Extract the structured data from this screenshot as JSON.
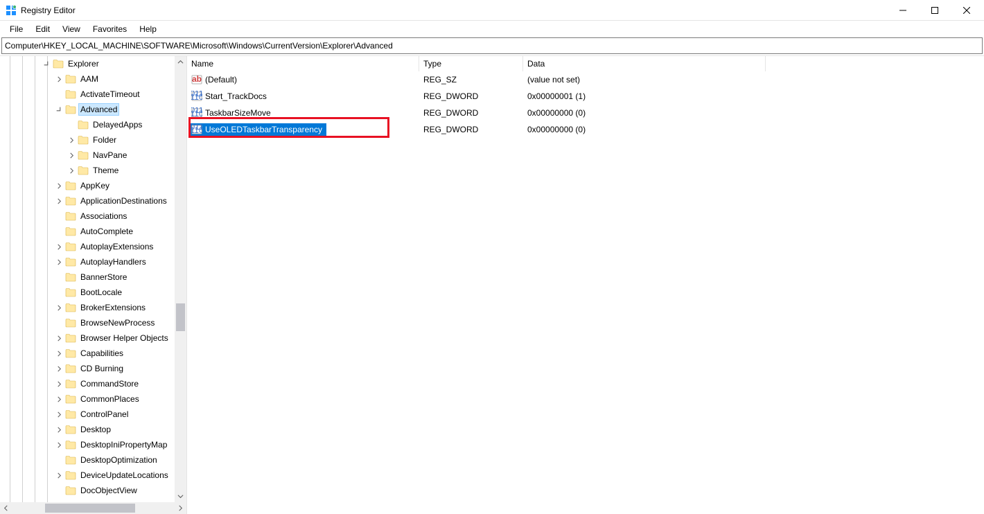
{
  "window": {
    "title": "Registry Editor"
  },
  "menu": [
    "File",
    "Edit",
    "View",
    "Favorites",
    "Help"
  ],
  "address": "Computer\\HKEY_LOCAL_MACHINE\\SOFTWARE\\Microsoft\\Windows\\CurrentVersion\\Explorer\\Advanced",
  "tree": [
    {
      "level": 3,
      "label": "Explorer",
      "expander": "open",
      "selected": false
    },
    {
      "level": 4,
      "label": "AAM",
      "expander": "closed"
    },
    {
      "level": 4,
      "label": "ActivateTimeout",
      "expander": "none"
    },
    {
      "level": 4,
      "label": "Advanced",
      "expander": "open",
      "selected": true
    },
    {
      "level": 5,
      "label": "DelayedApps",
      "expander": "none"
    },
    {
      "level": 5,
      "label": "Folder",
      "expander": "closed"
    },
    {
      "level": 5,
      "label": "NavPane",
      "expander": "closed"
    },
    {
      "level": 5,
      "label": "Theme",
      "expander": "closed"
    },
    {
      "level": 4,
      "label": "AppKey",
      "expander": "closed"
    },
    {
      "level": 4,
      "label": "ApplicationDestinations",
      "expander": "closed"
    },
    {
      "level": 4,
      "label": "Associations",
      "expander": "none"
    },
    {
      "level": 4,
      "label": "AutoComplete",
      "expander": "none"
    },
    {
      "level": 4,
      "label": "AutoplayExtensions",
      "expander": "closed"
    },
    {
      "level": 4,
      "label": "AutoplayHandlers",
      "expander": "closed"
    },
    {
      "level": 4,
      "label": "BannerStore",
      "expander": "none"
    },
    {
      "level": 4,
      "label": "BootLocale",
      "expander": "none"
    },
    {
      "level": 4,
      "label": "BrokerExtensions",
      "expander": "closed"
    },
    {
      "level": 4,
      "label": "BrowseNewProcess",
      "expander": "none"
    },
    {
      "level": 4,
      "label": "Browser Helper Objects",
      "expander": "closed"
    },
    {
      "level": 4,
      "label": "Capabilities",
      "expander": "closed"
    },
    {
      "level": 4,
      "label": "CD Burning",
      "expander": "closed"
    },
    {
      "level": 4,
      "label": "CommandStore",
      "expander": "closed"
    },
    {
      "level": 4,
      "label": "CommonPlaces",
      "expander": "closed"
    },
    {
      "level": 4,
      "label": "ControlPanel",
      "expander": "closed"
    },
    {
      "level": 4,
      "label": "Desktop",
      "expander": "closed"
    },
    {
      "level": 4,
      "label": "DesktopIniPropertyMap",
      "expander": "closed"
    },
    {
      "level": 4,
      "label": "DesktopOptimization",
      "expander": "none"
    },
    {
      "level": 4,
      "label": "DeviceUpdateLocations",
      "expander": "closed"
    },
    {
      "level": 4,
      "label": "DocObjectView",
      "expander": "none"
    }
  ],
  "list": {
    "columns": {
      "name": "Name",
      "type": "Type",
      "data": "Data"
    },
    "rows": [
      {
        "icon": "sz",
        "name": "(Default)",
        "type": "REG_SZ",
        "data": "(value not set)",
        "selected": false
      },
      {
        "icon": "dw",
        "name": "Start_TrackDocs",
        "type": "REG_DWORD",
        "data": "0x00000001 (1)",
        "selected": false
      },
      {
        "icon": "dw",
        "name": "TaskbarSizeMove",
        "type": "REG_DWORD",
        "data": "0x00000000 (0)",
        "selected": false
      },
      {
        "icon": "dw",
        "name": "UseOLEDTaskbarTransparency",
        "type": "REG_DWORD",
        "data": "0x00000000 (0)",
        "selected": true,
        "highlighted": true
      }
    ]
  }
}
